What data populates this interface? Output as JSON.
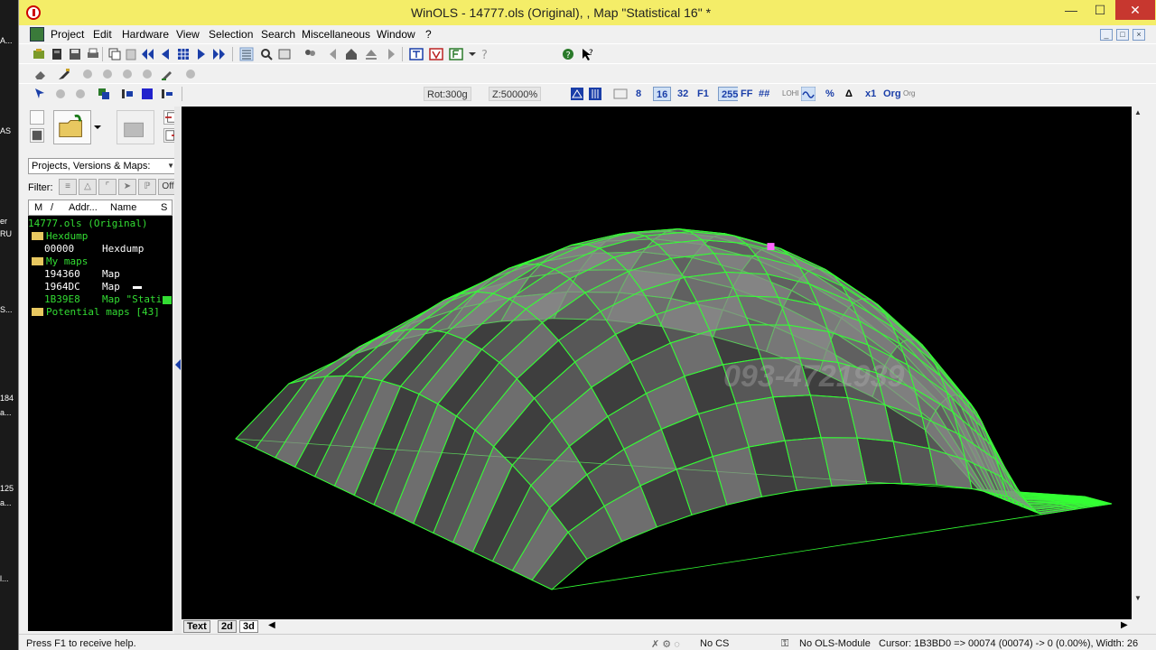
{
  "desktop": {
    "labels": [
      "A...",
      "AS",
      "er",
      "RU",
      "S...",
      "184",
      "a...",
      "125",
      "a...",
      "l..."
    ]
  },
  "window": {
    "title": "WinOLS - 14777.ols (Original), , Map \"Statistical 16\" *",
    "title_bar_color": "#f4ed68",
    "minimize": "—",
    "maximize": "☐",
    "close": "✕"
  },
  "menu": {
    "items": [
      "Project",
      "Edit",
      "Hardware",
      "View",
      "Selection",
      "Search",
      "Miscellaneous",
      "Window",
      "?"
    ],
    "mdi_buttons": [
      "_",
      "□",
      "×"
    ]
  },
  "toolbar3": {
    "rotation": "Rot:300g",
    "zoom": "Z:50000%",
    "buttons": [
      "8",
      "16",
      "32",
      "F1",
      "255",
      "FF",
      "##",
      "LOHI",
      "%",
      "Δ",
      "x1",
      "Org",
      "Org"
    ]
  },
  "left_panel": {
    "combo_value": "Projects, Versions & Maps:",
    "filter_label": "Filter:",
    "filter_off": "Off",
    "columns": [
      "M",
      "/",
      "Addr...",
      "Name",
      "S"
    ],
    "tree": [
      {
        "text": "14777.ols (Original)",
        "color": "#33dd33",
        "indent": 0,
        "folder": false
      },
      {
        "text": "Hexdump",
        "color": "#33dd33",
        "indent": 4,
        "folder": true
      },
      {
        "addr": "00000",
        "name": "Hexdump",
        "color": "#ffffff",
        "indent": 18
      },
      {
        "text": "My maps",
        "color": "#33dd33",
        "indent": 4,
        "folder": true
      },
      {
        "addr": "194360",
        "name": "Map",
        "color": "#ffffff",
        "indent": 18
      },
      {
        "addr": "1964DC",
        "name": "Map",
        "color": "#ffffff",
        "indent": 18
      },
      {
        "addr": "1B39E8",
        "name": "Map \"Stati",
        "color": "#33dd33",
        "indent": 18
      },
      {
        "text": "Potential maps [43]",
        "color": "#33dd33",
        "indent": 4,
        "folder": true
      }
    ]
  },
  "graph": {
    "mesh_color": "#33ff33",
    "surface_color": "#8a8a8a",
    "watermark_phone": "093-4721939"
  },
  "bottom_tabs": [
    "Text",
    "2d",
    "3d"
  ],
  "status": {
    "help": "Press F1 to receive help.",
    "cs": "No CS",
    "module": "No OLS-Module",
    "cursor": "Cursor: 1B3BD0 => 00074 (00074) -> 0 (0.00%), Width: 26"
  }
}
